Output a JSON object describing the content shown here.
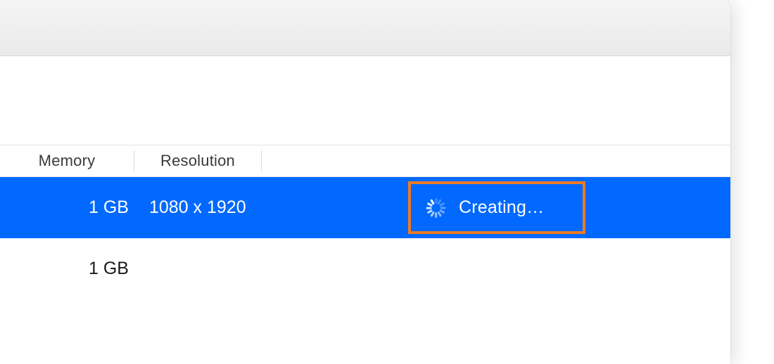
{
  "columns": {
    "memory": "Memory",
    "resolution": "Resolution"
  },
  "rows": [
    {
      "memory": "1 GB",
      "resolution": "1080 x 1920",
      "status_text": "Creating…",
      "selected": true,
      "highlighted": true
    },
    {
      "memory": "1 GB",
      "resolution": "",
      "status_text": "",
      "selected": false,
      "highlighted": false
    }
  ],
  "colors": {
    "selection": "#0169ff",
    "highlight_border": "#ee7a24"
  }
}
